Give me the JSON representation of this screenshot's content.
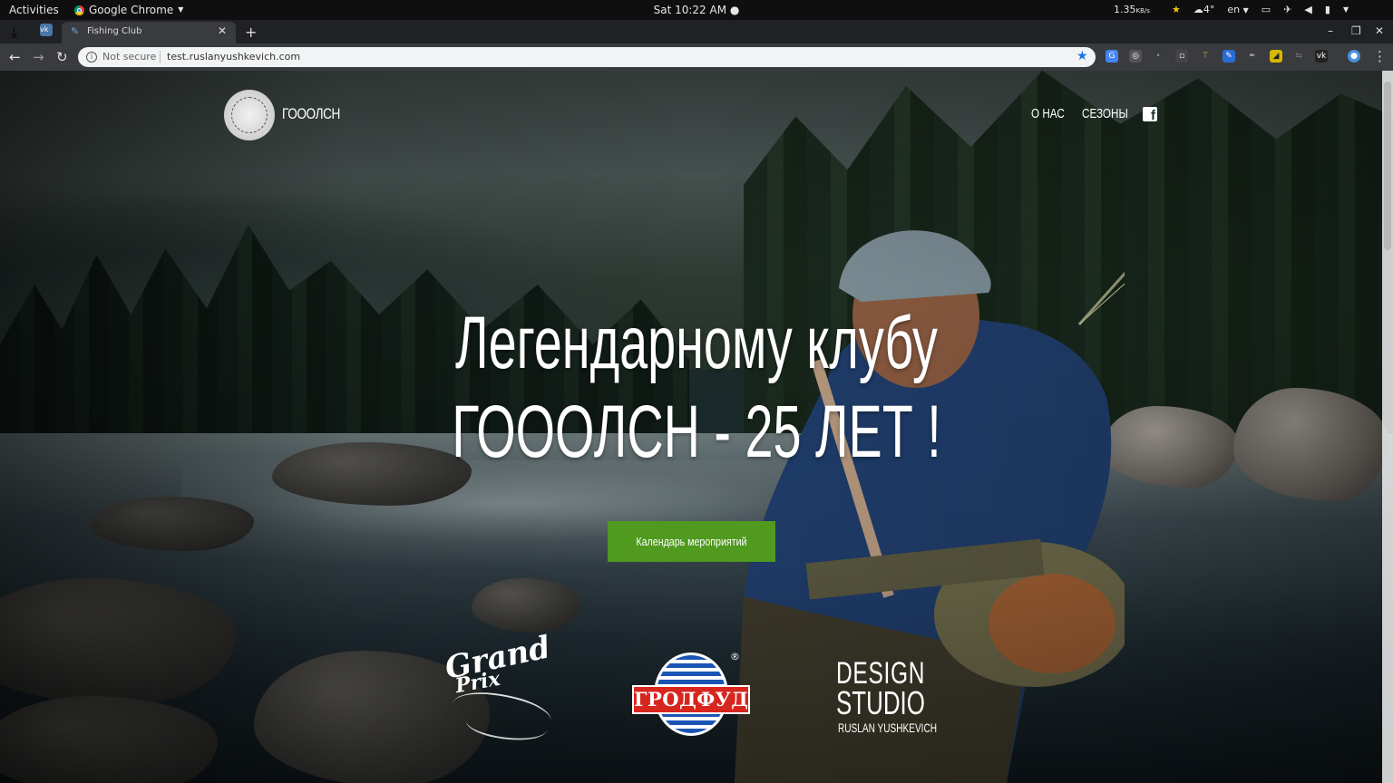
{
  "gnome": {
    "activities": "Activities",
    "app_name": "Google Chrome",
    "clock": "Sat 10:22 AM",
    "net_speed": "1.35",
    "net_unit": "KB/s",
    "weather": "4°",
    "lang": "en"
  },
  "browser": {
    "tab_title": "Fishing Club",
    "not_secure": "Not secure",
    "url": "test.ruslanyushkevich.com"
  },
  "site": {
    "brand": "ГОООЛСН",
    "nav": [
      "О НАС",
      "СЕЗОНЫ"
    ],
    "hero_line1": "Легендарному клубу",
    "hero_line2": "ГОООЛСН - 25 ЛЕТ !",
    "cta": "Календарь мероприятий",
    "sponsors": {
      "grand_prix_l1": "Grand",
      "grand_prix_l2": "Prix",
      "grodfud": "ГРОДФУД",
      "grodfud_reg": "®",
      "design_l1": "DESIGN",
      "design_l2": "STUDIO",
      "design_l3": "RUSLAN YUSHKEVICH"
    }
  },
  "colors": {
    "cta_green": "#4f9a1f",
    "grodfud_red": "#d7261e",
    "grodfud_blue": "#1a55b4",
    "chrome_star": "#1a73e8"
  }
}
